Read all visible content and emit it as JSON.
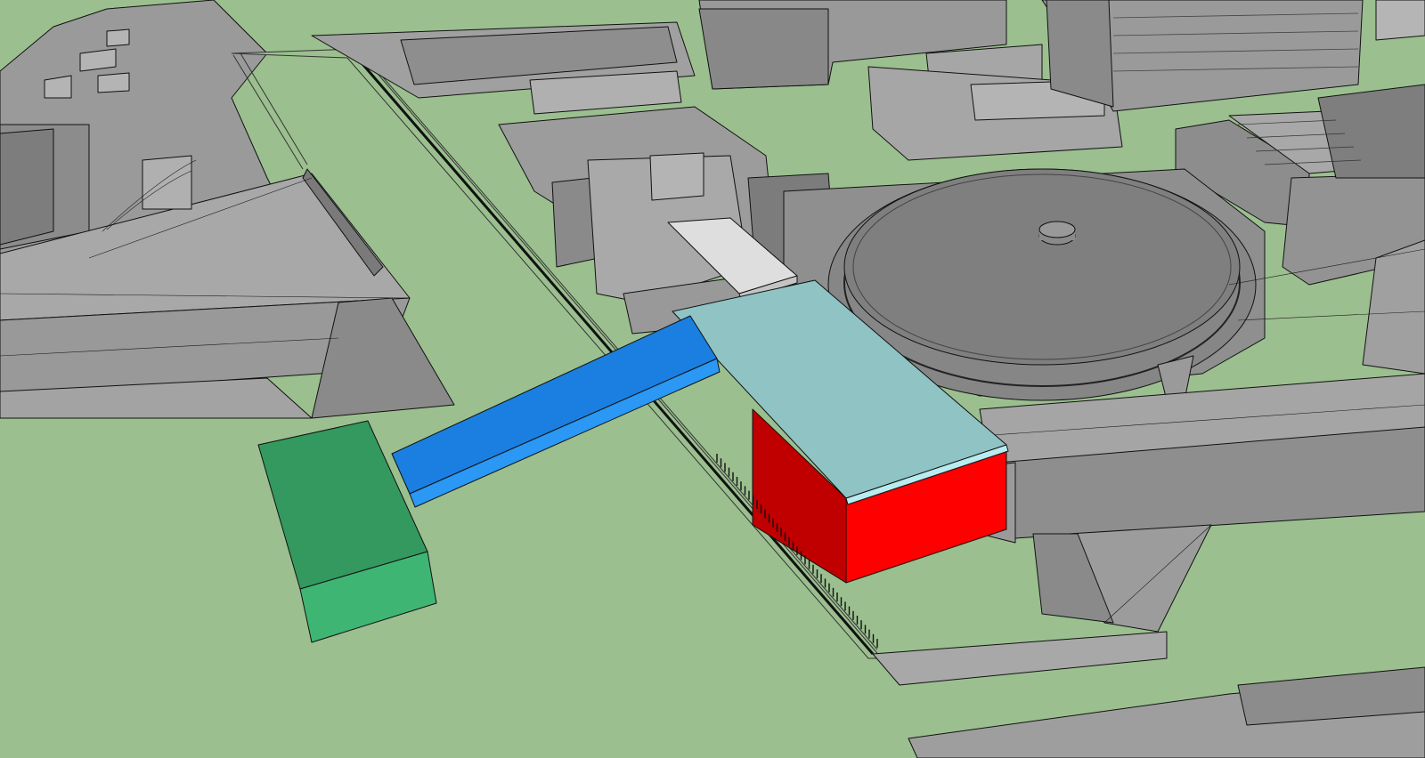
{
  "scene": {
    "type": "3d-massing-model-viewport",
    "colors": {
      "ground": "#9bbf8f",
      "context_light": "#a9a9a9",
      "context_mid": "#8e8e8e",
      "context_dark": "#6b6b6b",
      "context_top": "#b8b8b8",
      "mass_green_top": "#33995e",
      "mass_green_side": "#3fb574",
      "mass_blue_top": "#1a7fe0",
      "mass_blue_side": "#2a98f4",
      "mass_lightblue_top": "#8fc3c4",
      "mass_lightblue_edge": "#b8ecef",
      "mass_red_front": "#ff0000",
      "mass_red_side": "#c20000",
      "mass_white_top": "#dedede"
    },
    "highlighted_masses": [
      {
        "id": "green-block",
        "color": "green"
      },
      {
        "id": "blue-bridge",
        "color": "blue"
      },
      {
        "id": "lightblue-slab",
        "color": "light-blue"
      },
      {
        "id": "red-block",
        "color": "red"
      },
      {
        "id": "white-slab",
        "color": "white"
      }
    ]
  }
}
